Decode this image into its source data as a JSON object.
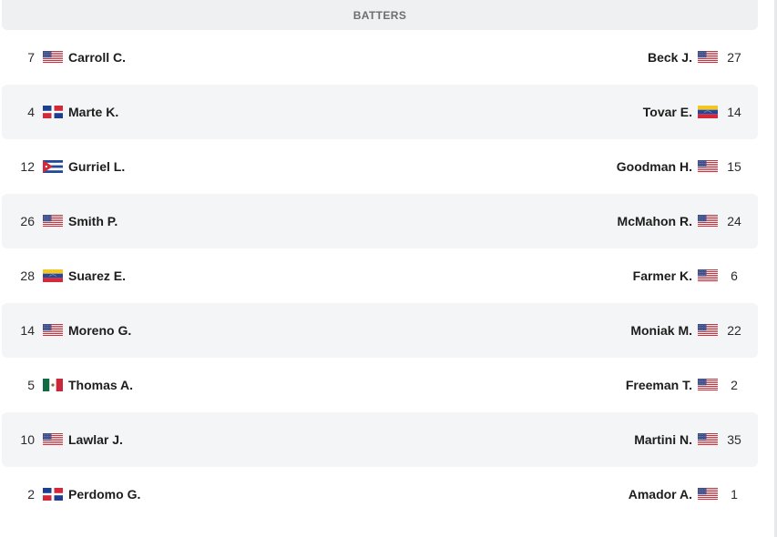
{
  "section": {
    "title": "BATTERS"
  },
  "rows": [
    {
      "left": {
        "number": "7",
        "name": "Carroll C.",
        "flag": "us-flag-icon"
      },
      "right": {
        "number": "27",
        "name": "Beck J.",
        "flag": "us-flag-icon"
      }
    },
    {
      "left": {
        "number": "4",
        "name": "Marte K.",
        "flag": "dominican-republic-flag-icon"
      },
      "right": {
        "number": "14",
        "name": "Tovar E.",
        "flag": "venezuela-flag-icon"
      }
    },
    {
      "left": {
        "number": "12",
        "name": "Gurriel L.",
        "flag": "cuba-flag-icon"
      },
      "right": {
        "number": "15",
        "name": "Goodman H.",
        "flag": "us-flag-icon"
      }
    },
    {
      "left": {
        "number": "26",
        "name": "Smith P.",
        "flag": "us-flag-icon"
      },
      "right": {
        "number": "24",
        "name": "McMahon R.",
        "flag": "us-flag-icon"
      }
    },
    {
      "left": {
        "number": "28",
        "name": "Suarez E.",
        "flag": "venezuela-flag-icon"
      },
      "right": {
        "number": "6",
        "name": "Farmer K.",
        "flag": "us-flag-icon"
      }
    },
    {
      "left": {
        "number": "14",
        "name": "Moreno G.",
        "flag": "us-flag-icon"
      },
      "right": {
        "number": "22",
        "name": "Moniak M.",
        "flag": "us-flag-icon"
      }
    },
    {
      "left": {
        "number": "5",
        "name": "Thomas A.",
        "flag": "mexico-flag-icon"
      },
      "right": {
        "number": "2",
        "name": "Freeman T.",
        "flag": "us-flag-icon"
      }
    },
    {
      "left": {
        "number": "10",
        "name": "Lawlar J.",
        "flag": "us-flag-icon"
      },
      "right": {
        "number": "35",
        "name": "Martini N.",
        "flag": "us-flag-icon"
      }
    },
    {
      "left": {
        "number": "2",
        "name": "Perdomo G.",
        "flag": "dominican-republic-flag-icon"
      },
      "right": {
        "number": "1",
        "name": "Amador A.",
        "flag": "us-flag-icon"
      }
    }
  ]
}
